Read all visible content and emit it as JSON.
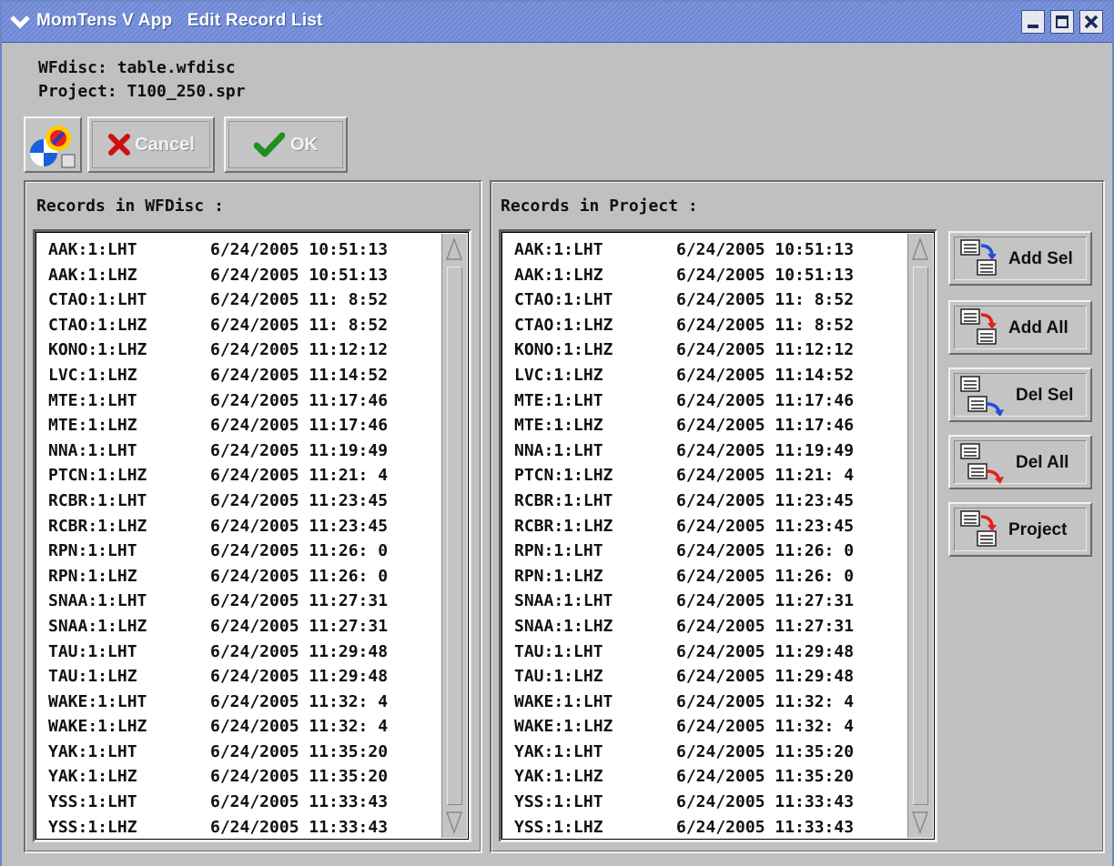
{
  "window": {
    "title": "MomTens V App   Edit Record List",
    "minimize_glyph": "–",
    "maximize_glyph": "□",
    "close_glyph": "✕"
  },
  "info": {
    "wfdisc_line": "WFdisc: table.wfdisc",
    "project_line": "Project: T100_250.spr"
  },
  "toolbar": {
    "logo_icon": "project-logo-icon",
    "cancel_label": "Cancel",
    "ok_label": "OK"
  },
  "wfdisc_panel": {
    "label": "Records in WFDisc :",
    "records": [
      {
        "station": "AAK:1:LHT",
        "datetime": "6/24/2005 10:51:13"
      },
      {
        "station": "AAK:1:LHZ",
        "datetime": "6/24/2005 10:51:13"
      },
      {
        "station": "CTAO:1:LHT",
        "datetime": "6/24/2005 11: 8:52"
      },
      {
        "station": "CTAO:1:LHZ",
        "datetime": "6/24/2005 11: 8:52"
      },
      {
        "station": "KONO:1:LHZ",
        "datetime": "6/24/2005 11:12:12"
      },
      {
        "station": "LVC:1:LHZ",
        "datetime": "6/24/2005 11:14:52"
      },
      {
        "station": "MTE:1:LHT",
        "datetime": "6/24/2005 11:17:46"
      },
      {
        "station": "MTE:1:LHZ",
        "datetime": "6/24/2005 11:17:46"
      },
      {
        "station": "NNA:1:LHT",
        "datetime": "6/24/2005 11:19:49"
      },
      {
        "station": "PTCN:1:LHZ",
        "datetime": "6/24/2005 11:21: 4"
      },
      {
        "station": "RCBR:1:LHT",
        "datetime": "6/24/2005 11:23:45"
      },
      {
        "station": "RCBR:1:LHZ",
        "datetime": "6/24/2005 11:23:45"
      },
      {
        "station": "RPN:1:LHT",
        "datetime": "6/24/2005 11:26: 0"
      },
      {
        "station": "RPN:1:LHZ",
        "datetime": "6/24/2005 11:26: 0"
      },
      {
        "station": "SNAA:1:LHT",
        "datetime": "6/24/2005 11:27:31"
      },
      {
        "station": "SNAA:1:LHZ",
        "datetime": "6/24/2005 11:27:31"
      },
      {
        "station": "TAU:1:LHT",
        "datetime": "6/24/2005 11:29:48"
      },
      {
        "station": "TAU:1:LHZ",
        "datetime": "6/24/2005 11:29:48"
      },
      {
        "station": "WAKE:1:LHT",
        "datetime": "6/24/2005 11:32: 4"
      },
      {
        "station": "WAKE:1:LHZ",
        "datetime": "6/24/2005 11:32: 4"
      },
      {
        "station": "YAK:1:LHT",
        "datetime": "6/24/2005 11:35:20"
      },
      {
        "station": "YAK:1:LHZ",
        "datetime": "6/24/2005 11:35:20"
      },
      {
        "station": "YSS:1:LHT",
        "datetime": "6/24/2005 11:33:43"
      },
      {
        "station": "YSS:1:LHZ",
        "datetime": "6/24/2005 11:33:43"
      }
    ]
  },
  "project_panel": {
    "label": "Records in Project :",
    "records": [
      {
        "station": "AAK:1:LHT",
        "datetime": "6/24/2005 10:51:13"
      },
      {
        "station": "AAK:1:LHZ",
        "datetime": "6/24/2005 10:51:13"
      },
      {
        "station": "CTAO:1:LHT",
        "datetime": "6/24/2005 11: 8:52"
      },
      {
        "station": "CTAO:1:LHZ",
        "datetime": "6/24/2005 11: 8:52"
      },
      {
        "station": "KONO:1:LHZ",
        "datetime": "6/24/2005 11:12:12"
      },
      {
        "station": "LVC:1:LHZ",
        "datetime": "6/24/2005 11:14:52"
      },
      {
        "station": "MTE:1:LHT",
        "datetime": "6/24/2005 11:17:46"
      },
      {
        "station": "MTE:1:LHZ",
        "datetime": "6/24/2005 11:17:46"
      },
      {
        "station": "NNA:1:LHT",
        "datetime": "6/24/2005 11:19:49"
      },
      {
        "station": "PTCN:1:LHZ",
        "datetime": "6/24/2005 11:21: 4"
      },
      {
        "station": "RCBR:1:LHT",
        "datetime": "6/24/2005 11:23:45"
      },
      {
        "station": "RCBR:1:LHZ",
        "datetime": "6/24/2005 11:23:45"
      },
      {
        "station": "RPN:1:LHT",
        "datetime": "6/24/2005 11:26: 0"
      },
      {
        "station": "RPN:1:LHZ",
        "datetime": "6/24/2005 11:26: 0"
      },
      {
        "station": "SNAA:1:LHT",
        "datetime": "6/24/2005 11:27:31"
      },
      {
        "station": "SNAA:1:LHZ",
        "datetime": "6/24/2005 11:27:31"
      },
      {
        "station": "TAU:1:LHT",
        "datetime": "6/24/2005 11:29:48"
      },
      {
        "station": "TAU:1:LHZ",
        "datetime": "6/24/2005 11:29:48"
      },
      {
        "station": "WAKE:1:LHT",
        "datetime": "6/24/2005 11:32: 4"
      },
      {
        "station": "WAKE:1:LHZ",
        "datetime": "6/24/2005 11:32: 4"
      },
      {
        "station": "YAK:1:LHT",
        "datetime": "6/24/2005 11:35:20"
      },
      {
        "station": "YAK:1:LHZ",
        "datetime": "6/24/2005 11:35:20"
      },
      {
        "station": "YSS:1:LHT",
        "datetime": "6/24/2005 11:33:43"
      },
      {
        "station": "YSS:1:LHZ",
        "datetime": "6/24/2005 11:33:43"
      }
    ]
  },
  "actions": {
    "add_sel": "Add Sel",
    "add_all": "Add All",
    "del_sel": "Del Sel",
    "del_all": "Del All",
    "project": "Project"
  },
  "colors": {
    "title_bar": "#7d95dc",
    "window_bg": "#c0c0c0",
    "list_bg": "#ffffff",
    "arrow_blue": "#1f4fd8",
    "arrow_red": "#e02020",
    "cancel_red": "#d01010",
    "ok_green": "#1f8f1f"
  }
}
